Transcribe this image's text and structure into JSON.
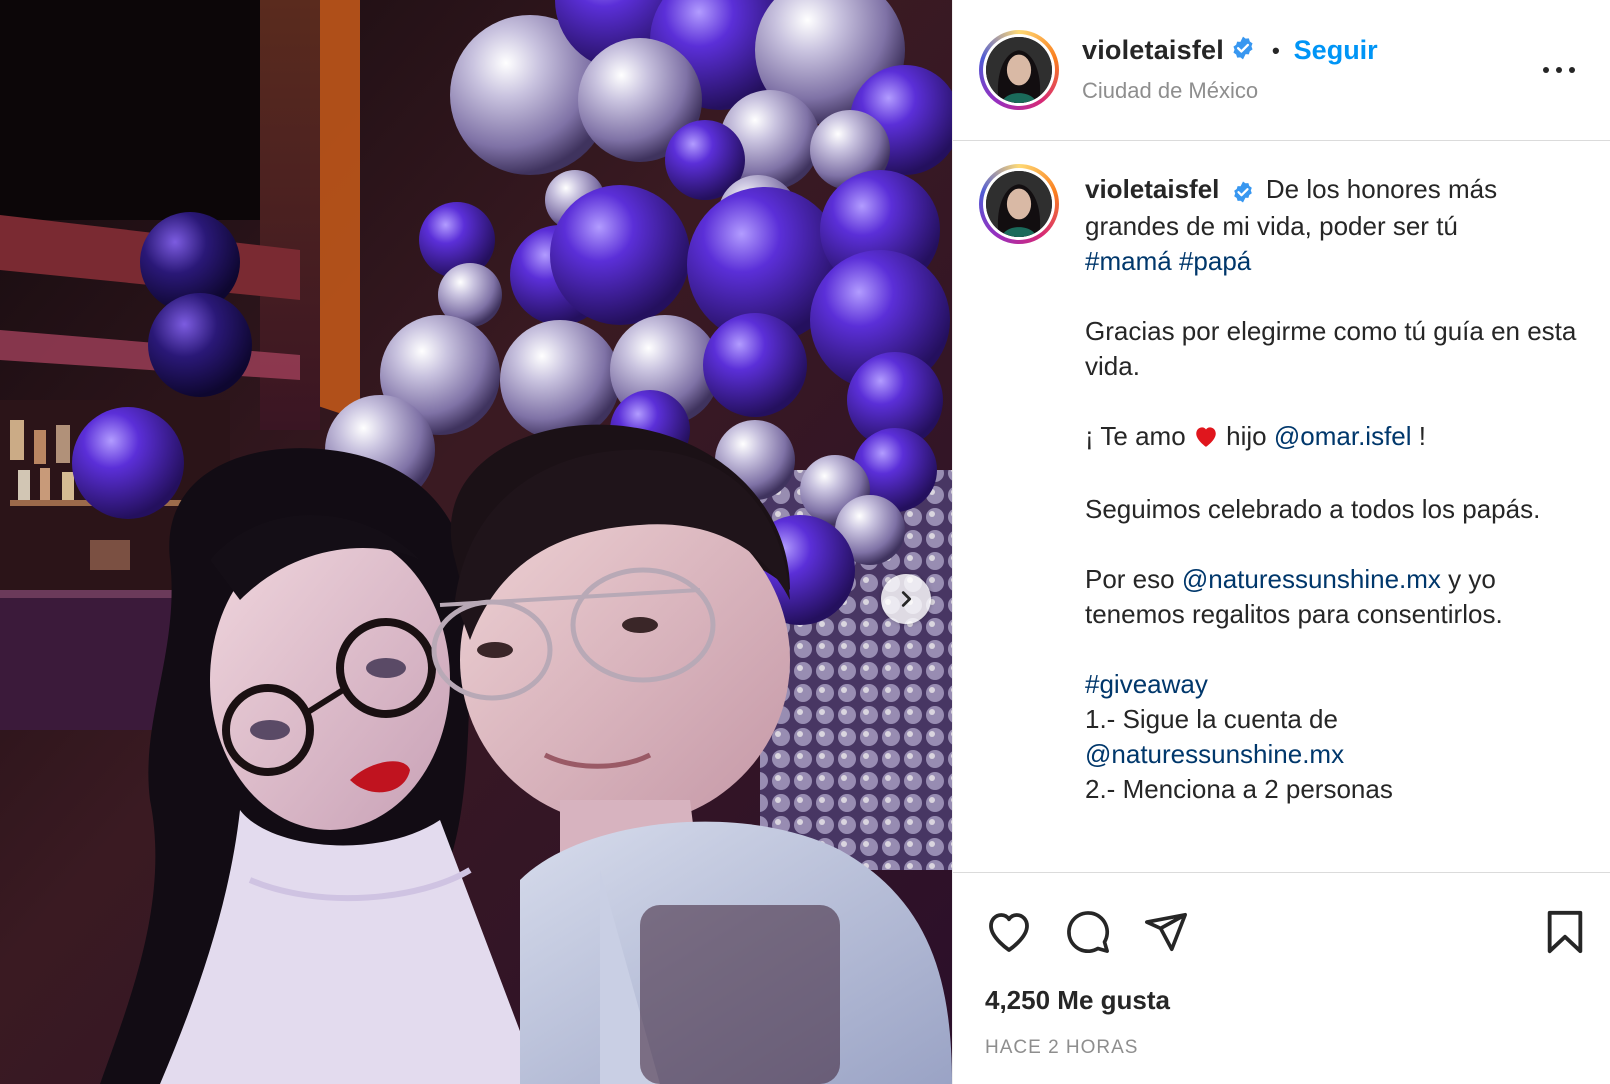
{
  "post": {
    "username": "violetaisfel",
    "follow_label": "Seguir",
    "separator": "•",
    "location": "Ciudad de México",
    "caption_lines": [
      {
        "id": "l1",
        "text": "De los honores más grandes de mi vida, poder ser tú"
      },
      {
        "id": "hashtags1",
        "tags": [
          "#mamá",
          "#papá"
        ]
      }
    ],
    "caption": {
      "intro": "De los honores más grandes de mi vida, poder ser tú",
      "tag1": "#mamá",
      "tag2": "#papá",
      "p2": "Gracias por elegirme como tú guía en esta vida.",
      "p3_a": "¡ Te amo",
      "p3_b": "hijo",
      "p3_mention": "@omar.isfel",
      "p3_end": "!",
      "p4": "Seguimos celebrado a todos los papás.",
      "p5_a": "Por eso",
      "p5_mention": "@naturessunshine.mx",
      "p5_b": "y yo tenemos regalitos para consentirlos.",
      "tag3": "#giveaway",
      "step1": "1.- Sigue la cuenta de",
      "step1_mention": "@naturessunshine.mx",
      "step2": "2.- Menciona a 2 personas"
    },
    "likes": "4,250 Me gusta",
    "time": "HACE 2 HORAS"
  },
  "icons": {
    "verified": "verified-badge-icon",
    "more": "more-options-icon",
    "like": "heart-outline-icon",
    "comment": "comment-icon",
    "share": "paper-plane-icon",
    "save": "bookmark-icon",
    "next": "chevron-right-icon",
    "heart_emoji": "red-heart-emoji"
  },
  "colors": {
    "link": "#00376b",
    "follow": "#0095f6",
    "verified": "#3897f0",
    "muted": "#8e8e8e"
  }
}
